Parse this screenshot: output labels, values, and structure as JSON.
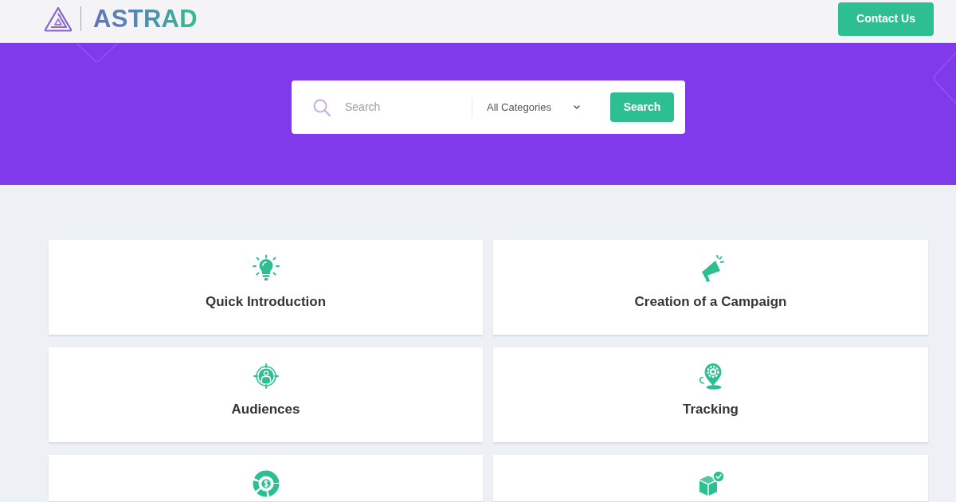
{
  "header": {
    "logo_text": "ASTRAD",
    "contact_button": "Contact Us"
  },
  "search": {
    "placeholder": "Search",
    "category": "All Categories",
    "button": "Search"
  },
  "categories": [
    {
      "kind": "lightbulb",
      "title": "Quick Introduction"
    },
    {
      "kind": "megaphone",
      "title": "Creation of a Campaign"
    },
    {
      "kind": "target",
      "title": "Audiences"
    },
    {
      "kind": "pin",
      "title": "Tracking"
    },
    {
      "kind": "donut"
    },
    {
      "kind": "box"
    }
  ]
}
